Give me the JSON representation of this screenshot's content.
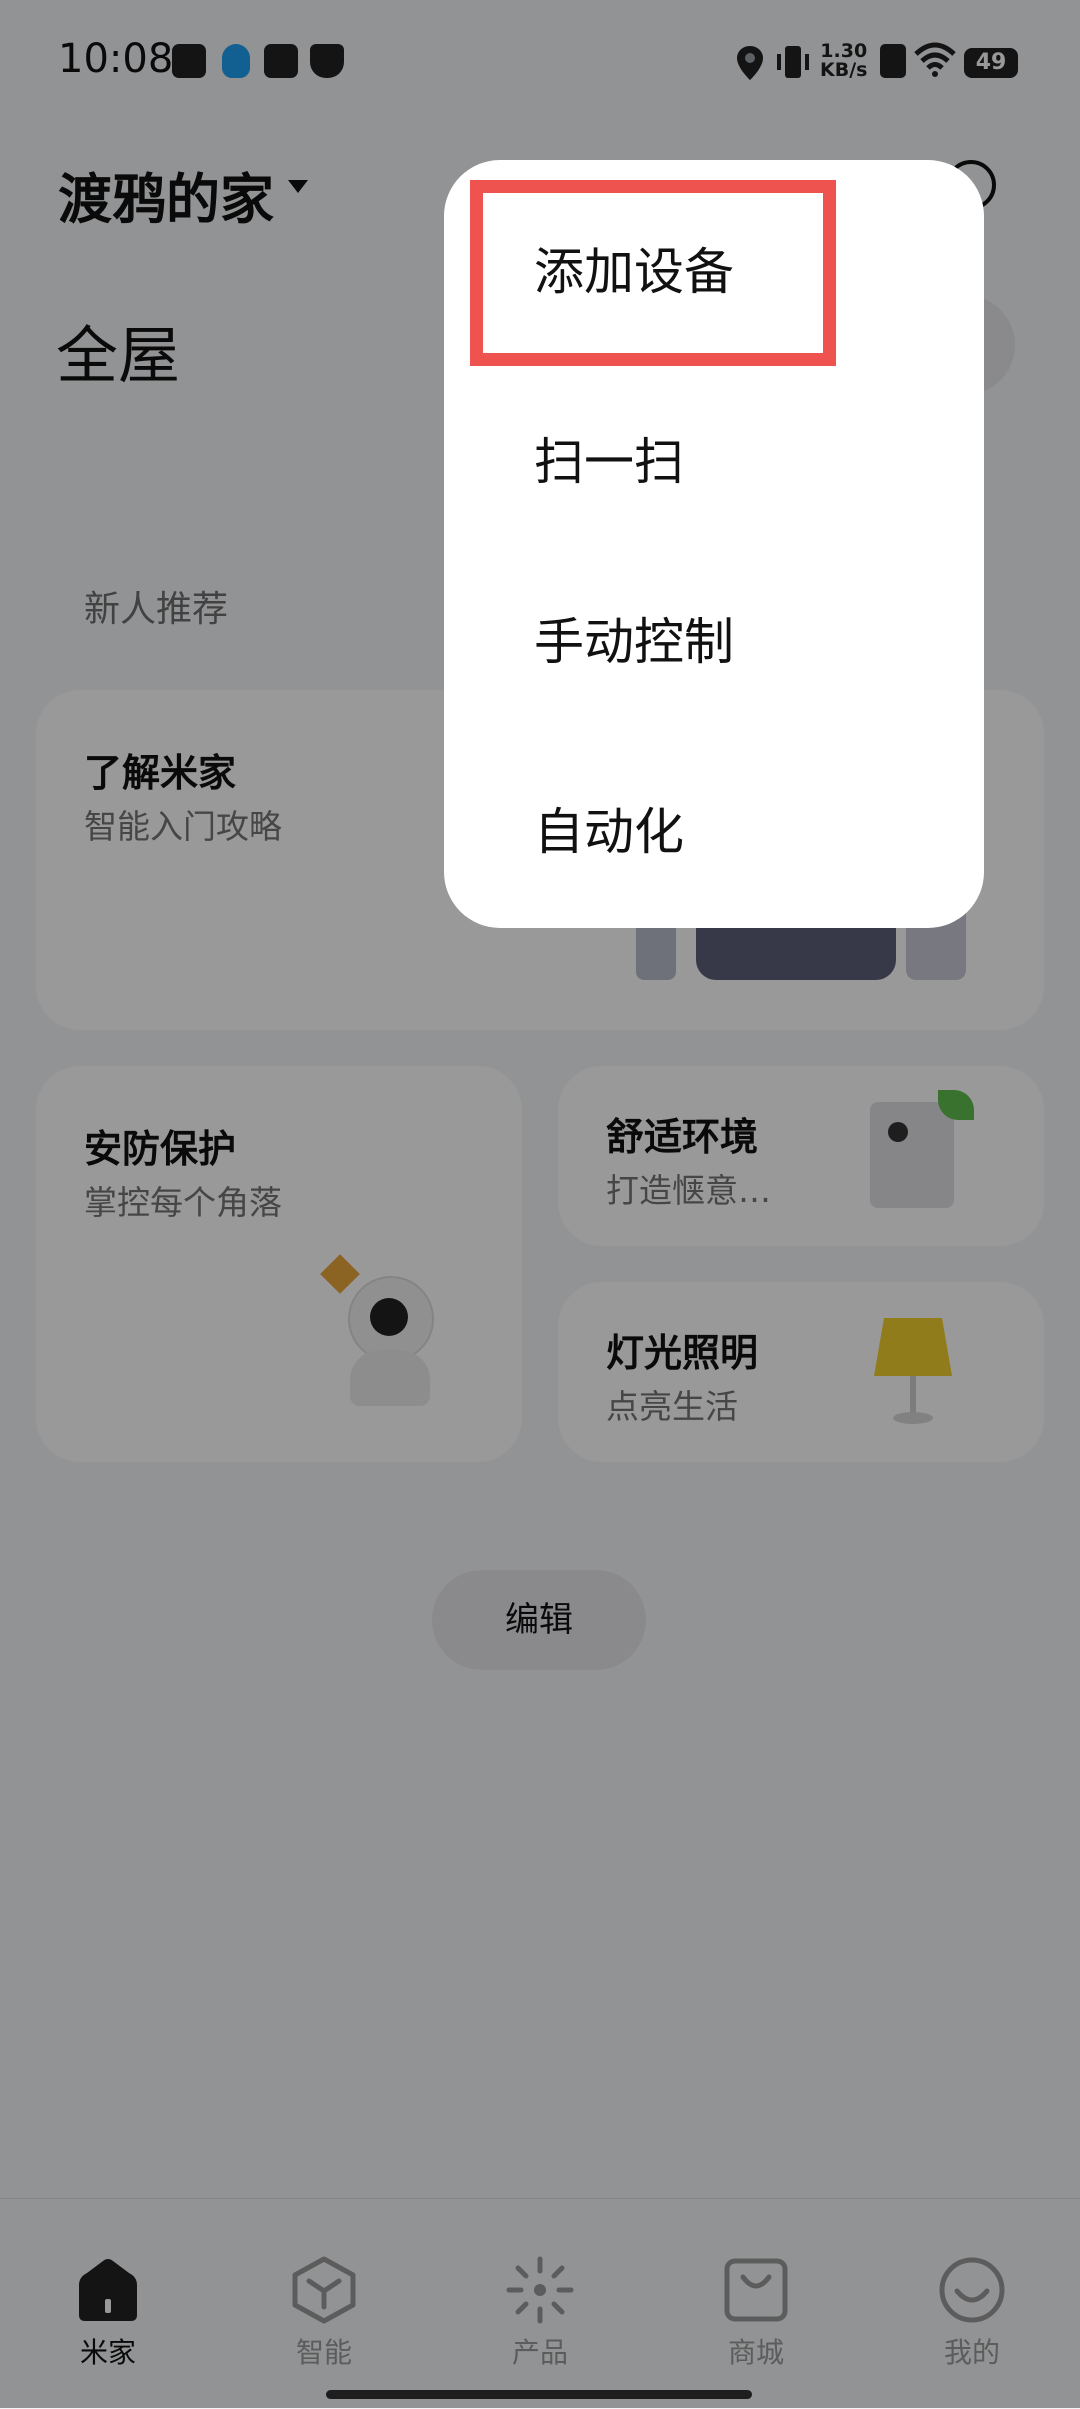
{
  "status_bar": {
    "time": "10:08",
    "net_speed": "1.30",
    "net_unit": "KB/s",
    "battery": "49"
  },
  "header": {
    "home_name": "渡鸦的家",
    "room": "全屋"
  },
  "section": {
    "label": "新人推荐"
  },
  "cards": {
    "learn": {
      "title": "了解米家",
      "subtitle": "智能入门攻略"
    },
    "security": {
      "title": "安防保护",
      "subtitle": "掌控每个角落"
    },
    "comfort": {
      "title": "舒适环境",
      "subtitle": "打造惬意…"
    },
    "lighting": {
      "title": "灯光照明",
      "subtitle": "点亮生活"
    }
  },
  "edit_label": "编辑",
  "tabs": [
    {
      "label": "米家",
      "icon": "home-icon",
      "active": true
    },
    {
      "label": "智能",
      "icon": "cube-icon",
      "active": false
    },
    {
      "label": "产品",
      "icon": "sparkle-icon",
      "active": false
    },
    {
      "label": "商城",
      "icon": "bag-icon",
      "active": false
    },
    {
      "label": "我的",
      "icon": "smile-icon",
      "active": false
    }
  ],
  "menu": {
    "items": [
      {
        "label": "添加设备"
      },
      {
        "label": "扫一扫"
      },
      {
        "label": "手动控制"
      },
      {
        "label": "自动化"
      }
    ]
  },
  "colors": {
    "highlight": "#ef5350",
    "overlay": "rgba(0,0,0,0.40)"
  }
}
